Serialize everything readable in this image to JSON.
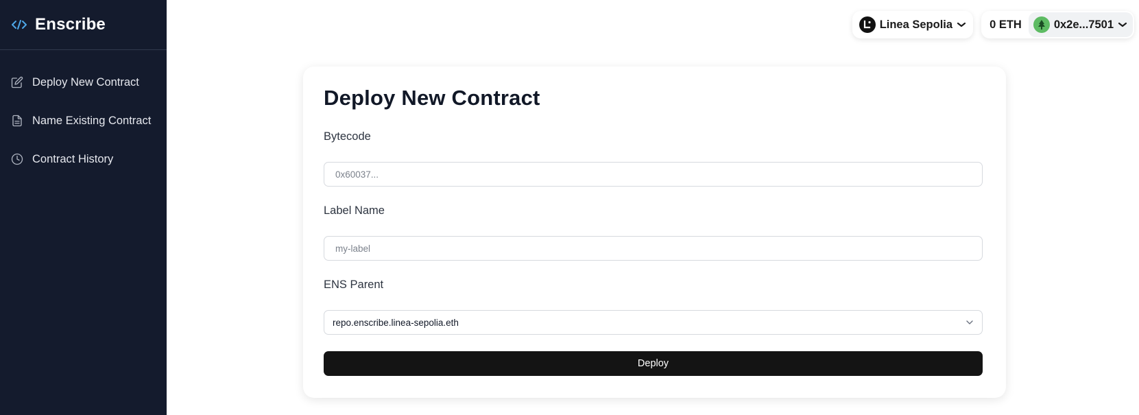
{
  "app": {
    "title": "Enscribe",
    "brand_icon": "code-icon"
  },
  "sidebar": {
    "items": [
      {
        "label": "Deploy New Contract",
        "icon": "edit-icon"
      },
      {
        "label": "Name Existing Contract",
        "icon": "document-icon"
      },
      {
        "label": "Contract History",
        "icon": "clock-icon"
      }
    ]
  },
  "header": {
    "network": {
      "name": "Linea Sepolia",
      "icon": "linea-logo-icon"
    },
    "balance": "0 ETH",
    "account": {
      "address": "0x2e...7501",
      "avatar": "tree-avatar-icon"
    }
  },
  "form": {
    "title": "Deploy New Contract",
    "bytecode": {
      "label": "Bytecode",
      "placeholder": "0x60037...",
      "value": ""
    },
    "label_name": {
      "label": "Label Name",
      "placeholder": "my-label",
      "value": ""
    },
    "ens_parent": {
      "label": "ENS Parent",
      "selected": "repo.enscribe.linea-sepolia.eth"
    },
    "submit_label": "Deploy"
  },
  "colors": {
    "sidebar_bg": "#141b2d",
    "accent_icon": "#4ea8e8",
    "button_bg": "#141414",
    "avatar_bg": "#5dbb63"
  }
}
